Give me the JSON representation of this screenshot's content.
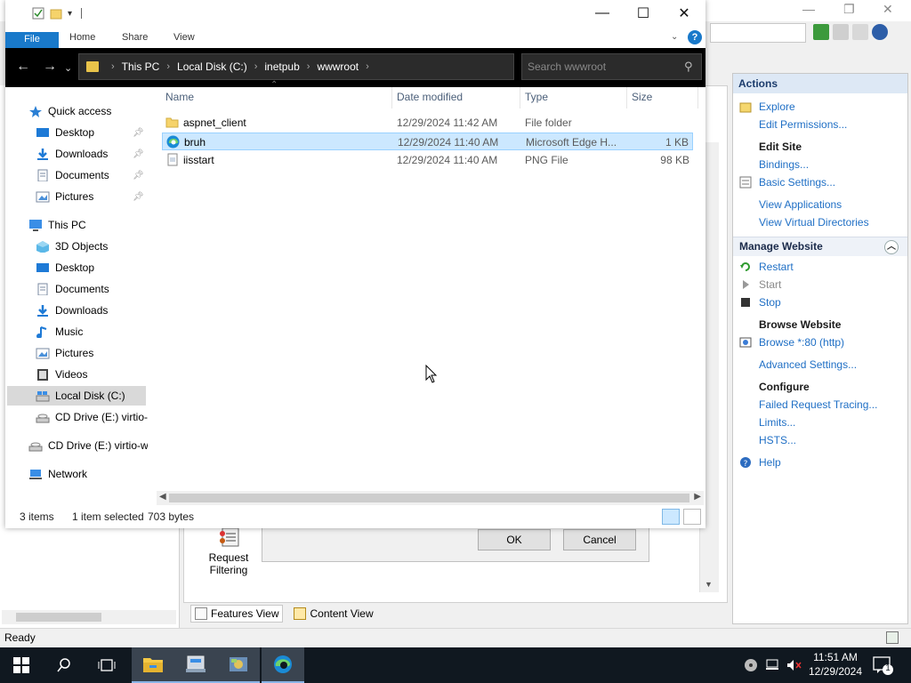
{
  "iis": {
    "status": "Ready",
    "actions_title": "Actions",
    "actions": {
      "explore": "Explore",
      "edit_permissions": "Edit Permissions...",
      "edit_site": "Edit Site",
      "bindings": "Bindings...",
      "basic_settings": "Basic Settings...",
      "view_applications": "View Applications",
      "view_virtual_directories": "View Virtual Directories",
      "manage_website": "Manage Website",
      "restart": "Restart",
      "start": "Start",
      "stop": "Stop",
      "browse_website": "Browse Website",
      "browse_80": "Browse *:80 (http)",
      "advanced_settings": "Advanced Settings...",
      "configure": "Configure",
      "failed_request_tracing": "Failed Request Tracing...",
      "limits": "Limits...",
      "hsts": "HSTS...",
      "help": "Help"
    },
    "request_filtering": "Request Filtering",
    "features_view": "Features View",
    "content_view": "Content View",
    "dialog_ok": "OK",
    "dialog_cancel": "Cancel"
  },
  "explorer": {
    "ribbon": {
      "file": "File",
      "home": "Home",
      "share": "Share",
      "view": "View"
    },
    "address": {
      "crumbs": [
        "This PC",
        "Local Disk (C:)",
        "inetpub",
        "wwwroot"
      ]
    },
    "search": {
      "placeholder": "Search wwwroot"
    },
    "nav": {
      "quick_access": "Quick access",
      "qa_desktop": "Desktop",
      "qa_downloads": "Downloads",
      "qa_documents": "Documents",
      "qa_pictures": "Pictures",
      "this_pc": "This PC",
      "objects_3d": "3D Objects",
      "desktop": "Desktop",
      "documents": "Documents",
      "downloads": "Downloads",
      "music": "Music",
      "pictures": "Pictures",
      "videos": "Videos",
      "local_disk": "Local Disk (C:)",
      "cd_drive_sub": "CD Drive (E:) virtio-w",
      "cd_drive": "CD Drive (E:) virtio-w",
      "network": "Network"
    },
    "columns": {
      "name": "Name",
      "date": "Date modified",
      "type": "Type",
      "size": "Size"
    },
    "files": [
      {
        "name": "aspnet_client",
        "date": "12/29/2024 11:42 AM",
        "type": "File folder",
        "size": "",
        "icon": "folder-icon"
      },
      {
        "name": "bruh",
        "date": "12/29/2024 11:40 AM",
        "type": "Microsoft Edge H...",
        "size": "1 KB",
        "icon": "edge-icon"
      },
      {
        "name": "iisstart",
        "date": "12/29/2024 11:40 AM",
        "type": "PNG File",
        "size": "98 KB",
        "icon": "png-file-icon"
      }
    ],
    "status": {
      "items": "3 items",
      "selected": "1 item selected",
      "bytes": "703 bytes"
    }
  },
  "taskbar": {
    "time": "11:51 AM",
    "date": "12/29/2024",
    "notifications": "1"
  },
  "colors": {
    "accent": "#1979ca",
    "selection": "#cce8ff",
    "link": "#1f6fc5",
    "taskbar": "#101820"
  }
}
